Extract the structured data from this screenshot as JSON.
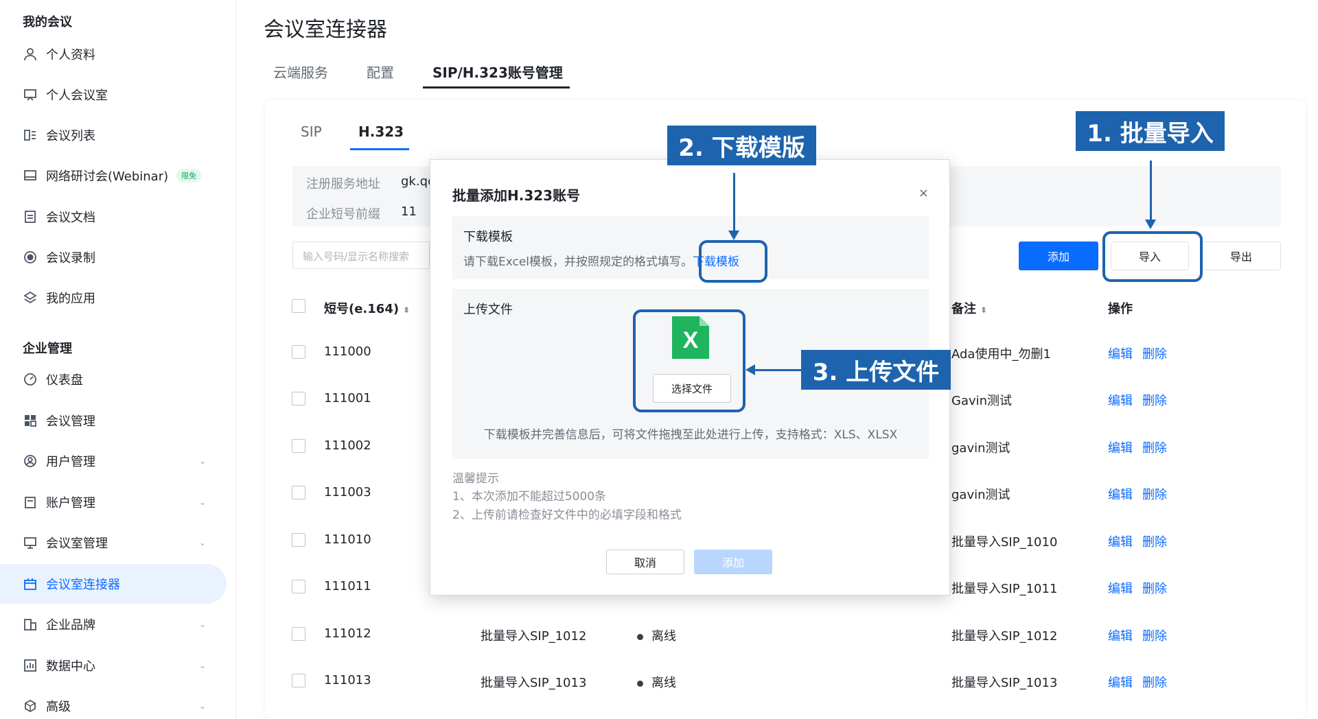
{
  "sidebar": {
    "section_my": "我的会议",
    "section_enterprise": "企业管理",
    "items": [
      {
        "label": "个人资料",
        "icon": "user-icon"
      },
      {
        "label": "个人会议室",
        "icon": "meeting-room-icon"
      },
      {
        "label": "会议列表",
        "icon": "list-icon"
      },
      {
        "label": "网络研讨会(Webinar)",
        "icon": "webinar-icon",
        "badge": "限免"
      },
      {
        "label": "会议文档",
        "icon": "document-icon"
      },
      {
        "label": "会议录制",
        "icon": "record-icon"
      },
      {
        "label": "我的应用",
        "icon": "apps-icon"
      },
      {
        "label": "仪表盘",
        "icon": "dashboard-icon"
      },
      {
        "label": "会议管理",
        "icon": "grid-icon"
      },
      {
        "label": "用户管理",
        "icon": "user-manage-icon"
      },
      {
        "label": "账户管理",
        "icon": "account-icon"
      },
      {
        "label": "会议室管理",
        "icon": "room-manage-icon"
      },
      {
        "label": "会议室连接器",
        "icon": "connector-icon"
      },
      {
        "label": "企业品牌",
        "icon": "brand-icon"
      },
      {
        "label": "数据中心",
        "icon": "data-icon"
      },
      {
        "label": "高级",
        "icon": "advanced-icon"
      }
    ]
  },
  "page": {
    "title": "会议室连接器",
    "tabs": [
      "云端服务",
      "配置",
      "SIP/H.323账号管理"
    ],
    "sub_tabs": [
      "SIP",
      "H.323"
    ]
  },
  "info": {
    "server_label": "注册服务地址",
    "server_value": "gk.qc",
    "prefix_label": "企业短号前缀",
    "prefix_value": "11"
  },
  "toolbar": {
    "search_placeholder": "输入号码/显示名称搜索",
    "add": "添加",
    "import": "导入",
    "export": "导出"
  },
  "table": {
    "headers": {
      "short_no": "短号(e.164)",
      "remark": "备注",
      "ops": "操作"
    },
    "edit": "编辑",
    "delete": "删除",
    "rows": [
      {
        "no": "111000",
        "name": "",
        "status": "",
        "remark": "Ada使用中_勿删1"
      },
      {
        "no": "111001",
        "name": "",
        "status": "",
        "remark": "Gavin测试"
      },
      {
        "no": "111002",
        "name": "",
        "status": "",
        "remark": "gavin测试"
      },
      {
        "no": "111003",
        "name": "",
        "status": "",
        "remark": "gavin测试"
      },
      {
        "no": "111010",
        "name": "",
        "status": "",
        "remark": "批量导入SIP_1010"
      },
      {
        "no": "111011",
        "name": "",
        "status": "",
        "remark": "批量导入SIP_1011"
      },
      {
        "no": "111012",
        "name": "批量导入SIP_1012",
        "status": "离线",
        "remark": "批量导入SIP_1012"
      },
      {
        "no": "111013",
        "name": "批量导入SIP_1013",
        "status": "离线",
        "remark": "批量导入SIP_1013"
      }
    ]
  },
  "modal": {
    "title": "批量添加H.323账号",
    "close": "×",
    "download_title": "下载模板",
    "download_desc": "请下载Excel模板，并按照规定的格式填写。",
    "download_link": "下载模板",
    "upload_title": "上传文件",
    "choose_file": "选择文件",
    "upload_desc": "下载模板并完善信息后，可将文件拖拽至此处进行上传，支持格式：XLS、XLSX",
    "tips_title": "温馨提示",
    "tip1": "1、本次添加不能超过5000条",
    "tip2": "2、上传前请检查好文件中的必填字段和格式",
    "cancel": "取消",
    "add": "添加"
  },
  "callouts": {
    "step1": "1. 批量导入",
    "step2": "2. 下载模版",
    "step3": "3. 上传文件"
  },
  "colors": {
    "accent": "#0a6cff",
    "callout": "#1e63ad"
  }
}
